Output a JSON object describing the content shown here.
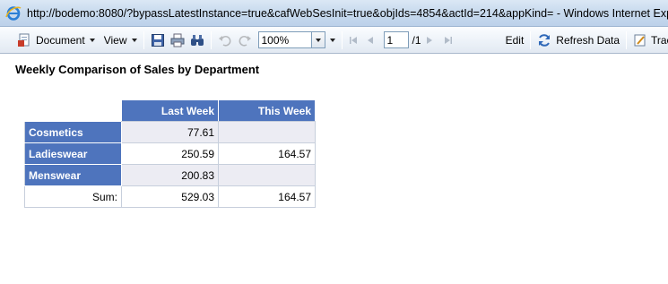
{
  "browser": {
    "title": "http://bodemo:8080/?bypassLatestInstance=true&cafWebSesInit=true&objIds=4854&actId=214&appKind= - Windows Internet Explorer"
  },
  "toolbar": {
    "document_label": "Document",
    "view_label": "View",
    "zoom_value": "100%",
    "page_value": "1",
    "page_total": "/1",
    "edit_label": "Edit",
    "refresh_label": "Refresh Data",
    "track_label": "Track"
  },
  "report": {
    "title": "Weekly Comparison of Sales by Department",
    "columns": [
      "Last Week",
      "This Week"
    ],
    "rows": [
      {
        "department": "Cosmetics",
        "last_week": "77.61",
        "this_week": ""
      },
      {
        "department": "Ladieswear",
        "last_week": "250.59",
        "this_week": "164.57"
      },
      {
        "department": "Menswear",
        "last_week": "200.83",
        "this_week": ""
      }
    ],
    "sum": {
      "label": "Sum:",
      "last_week": "529.03",
      "this_week": "164.57"
    }
  },
  "colors": {
    "header_blue": "#4e74bd",
    "shaded_row": "#ececf3"
  },
  "icons": {
    "browser": "ie-icon",
    "document": "document-icon",
    "save": "save-icon",
    "print": "print-icon",
    "find": "binoculars-icon",
    "undo": "undo-icon",
    "redo": "redo-icon",
    "refresh": "refresh-icon",
    "track": "track-changes-icon"
  }
}
